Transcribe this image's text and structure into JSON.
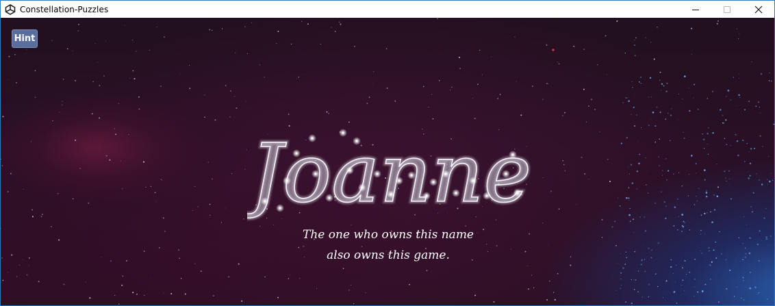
{
  "window": {
    "title": "Constellation-Puzzles",
    "icon": "unity-icon",
    "controls": [
      "minimize-icon",
      "maximize-icon",
      "close-icon"
    ]
  },
  "game": {
    "hint_label": "Hint",
    "constellation_name": "Joanne",
    "caption_line1": "The one who owns this name",
    "caption_line2": "also owns this game.",
    "colors": {
      "background": "#2a1026",
      "nebula_blue": "#286ec8",
      "nebula_red": "#821e46",
      "constellation_glow": "#e8e8f2",
      "hint_button": "#5a6e9d"
    }
  }
}
